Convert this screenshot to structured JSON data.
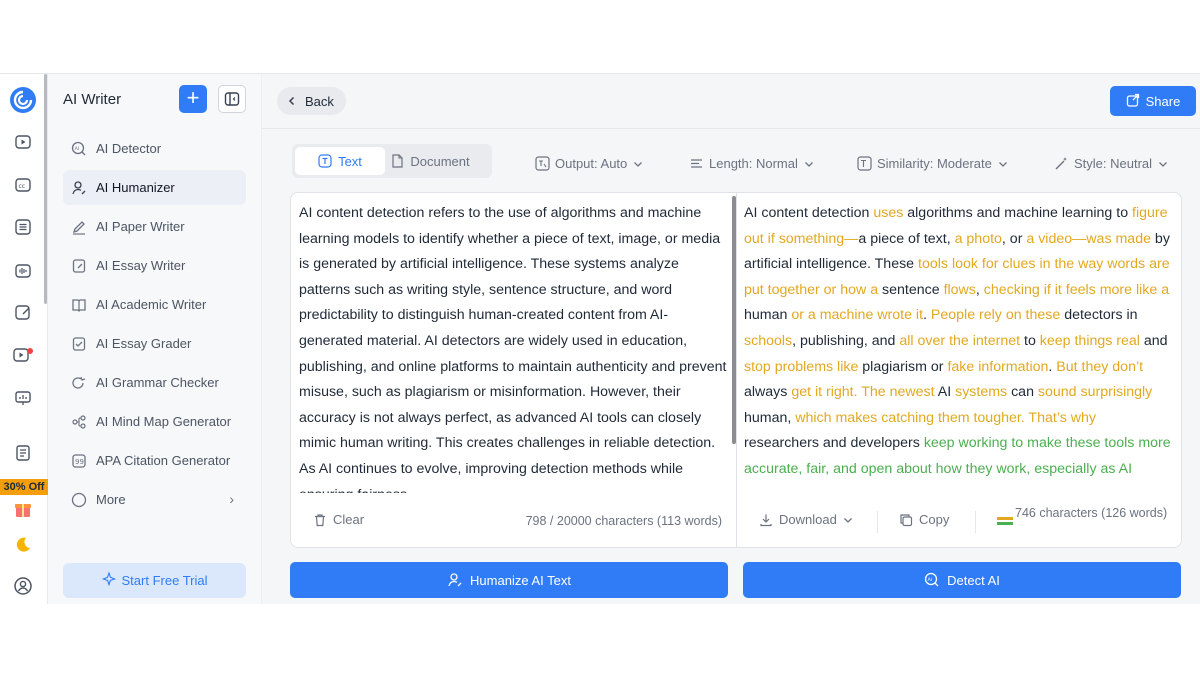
{
  "colors": {
    "accent": "#2f7cf6",
    "changed_word": "#e2a820",
    "rephrased": "#4caf50",
    "promo": "#f59e0b"
  },
  "rail": {
    "icons": [
      "logo-icon",
      "video-icon",
      "caption-icon",
      "list-icon",
      "audio-icon",
      "edit-image-icon",
      "record-icon",
      "presentation-icon",
      "document-icon",
      "gift-icon",
      "moon-icon",
      "user-icon"
    ],
    "promo_badge": "30% Off"
  },
  "sidebar": {
    "title": "AI Writer",
    "items": [
      {
        "label": "AI Detector",
        "icon": "ai-detector-icon"
      },
      {
        "label": "AI Humanizer",
        "icon": "humanizer-icon",
        "active": true
      },
      {
        "label": "AI Paper Writer",
        "icon": "pen-icon"
      },
      {
        "label": "AI Essay Writer",
        "icon": "essay-icon"
      },
      {
        "label": "AI Academic Writer",
        "icon": "book-icon"
      },
      {
        "label": "AI Essay Grader",
        "icon": "grader-icon"
      },
      {
        "label": "AI Grammar Checker",
        "icon": "grammar-icon"
      },
      {
        "label": "AI Mind Map Generator",
        "icon": "mindmap-icon"
      },
      {
        "label": "APA Citation Generator",
        "icon": "citation-icon"
      },
      {
        "label": "More",
        "icon": "more-icon"
      }
    ],
    "trial_label": "Start Free Trial"
  },
  "topbar": {
    "back_label": "Back",
    "share_label": "Share"
  },
  "modes": {
    "text_label": "Text",
    "document_label": "Document"
  },
  "options": {
    "output": "Output: Auto",
    "length": "Length: Normal",
    "similarity": "Similarity: Moderate",
    "style": "Style: Neutral"
  },
  "input": {
    "text": "AI content detection refers to the use of algorithms and machine learning models to identify whether a piece of text, image, or media is generated by artificial intelligence. These systems analyze patterns such as writing style, sentence structure, and word predictability to distinguish human-created content from AI-generated material. AI detectors are widely used in education, publishing, and online platforms to maintain authenticity and prevent misuse, such as plagiarism or misinformation. However, their accuracy is not always perfect, as advanced AI tools can closely mimic human writing. This creates challenges in reliable detection. As AI continues to evolve, improving detection methods while ensuring fairness",
    "clear_label": "Clear",
    "count": "798 / 20000 characters (113 words)"
  },
  "output": {
    "segments": [
      {
        "t": "AI content detection ",
        "s": "n"
      },
      {
        "t": "uses",
        "s": "c"
      },
      {
        "t": " algorithms and machine learning to ",
        "s": "n"
      },
      {
        "t": "figure out if something—",
        "s": "c"
      },
      {
        "t": "a piece of text, ",
        "s": "n"
      },
      {
        "t": "a photo",
        "s": "c"
      },
      {
        "t": ", or ",
        "s": "n"
      },
      {
        "t": "a video—was made",
        "s": "c"
      },
      {
        "t": " by artificial intelligence. These ",
        "s": "n"
      },
      {
        "t": "tools look for clues in the way words are put together or how a",
        "s": "c"
      },
      {
        "t": " sentence ",
        "s": "n"
      },
      {
        "t": "flows",
        "s": "c"
      },
      {
        "t": ", ",
        "s": "n"
      },
      {
        "t": "checking if it feels more like a",
        "s": "c"
      },
      {
        "t": " human ",
        "s": "n"
      },
      {
        "t": "or a machine wrote it",
        "s": "c"
      },
      {
        "t": ". ",
        "s": "n"
      },
      {
        "t": "People rely on these",
        "s": "c"
      },
      {
        "t": " detectors in ",
        "s": "n"
      },
      {
        "t": "schools",
        "s": "c"
      },
      {
        "t": ", publishing, and ",
        "s": "n"
      },
      {
        "t": "all over the internet",
        "s": "c"
      },
      {
        "t": " to ",
        "s": "n"
      },
      {
        "t": "keep things real",
        "s": "c"
      },
      {
        "t": " and ",
        "s": "n"
      },
      {
        "t": "stop problems like",
        "s": "c"
      },
      {
        "t": " plagiarism or ",
        "s": "n"
      },
      {
        "t": "fake information",
        "s": "c"
      },
      {
        "t": ". ",
        "s": "n"
      },
      {
        "t": "But they don’t",
        "s": "c"
      },
      {
        "t": " always ",
        "s": "n"
      },
      {
        "t": "get it right. The newest",
        "s": "c"
      },
      {
        "t": " AI ",
        "s": "n"
      },
      {
        "t": "systems",
        "s": "c"
      },
      {
        "t": " can ",
        "s": "n"
      },
      {
        "t": "sound surprisingly",
        "s": "c"
      },
      {
        "t": " human, ",
        "s": "n"
      },
      {
        "t": "which makes catching them tougher. That’s why",
        "s": "c"
      },
      {
        "t": " researchers and developers ",
        "s": "n"
      },
      {
        "t": "keep working to make these tools more accurate, fair, and open about how they work, especially as AI",
        "s": "g"
      }
    ],
    "download_label": "Download",
    "copy_label": "Copy",
    "count": "746 characters (126 words)"
  },
  "actions": {
    "humanize_label": "Humanize AI Text",
    "detect_label": "Detect AI"
  }
}
